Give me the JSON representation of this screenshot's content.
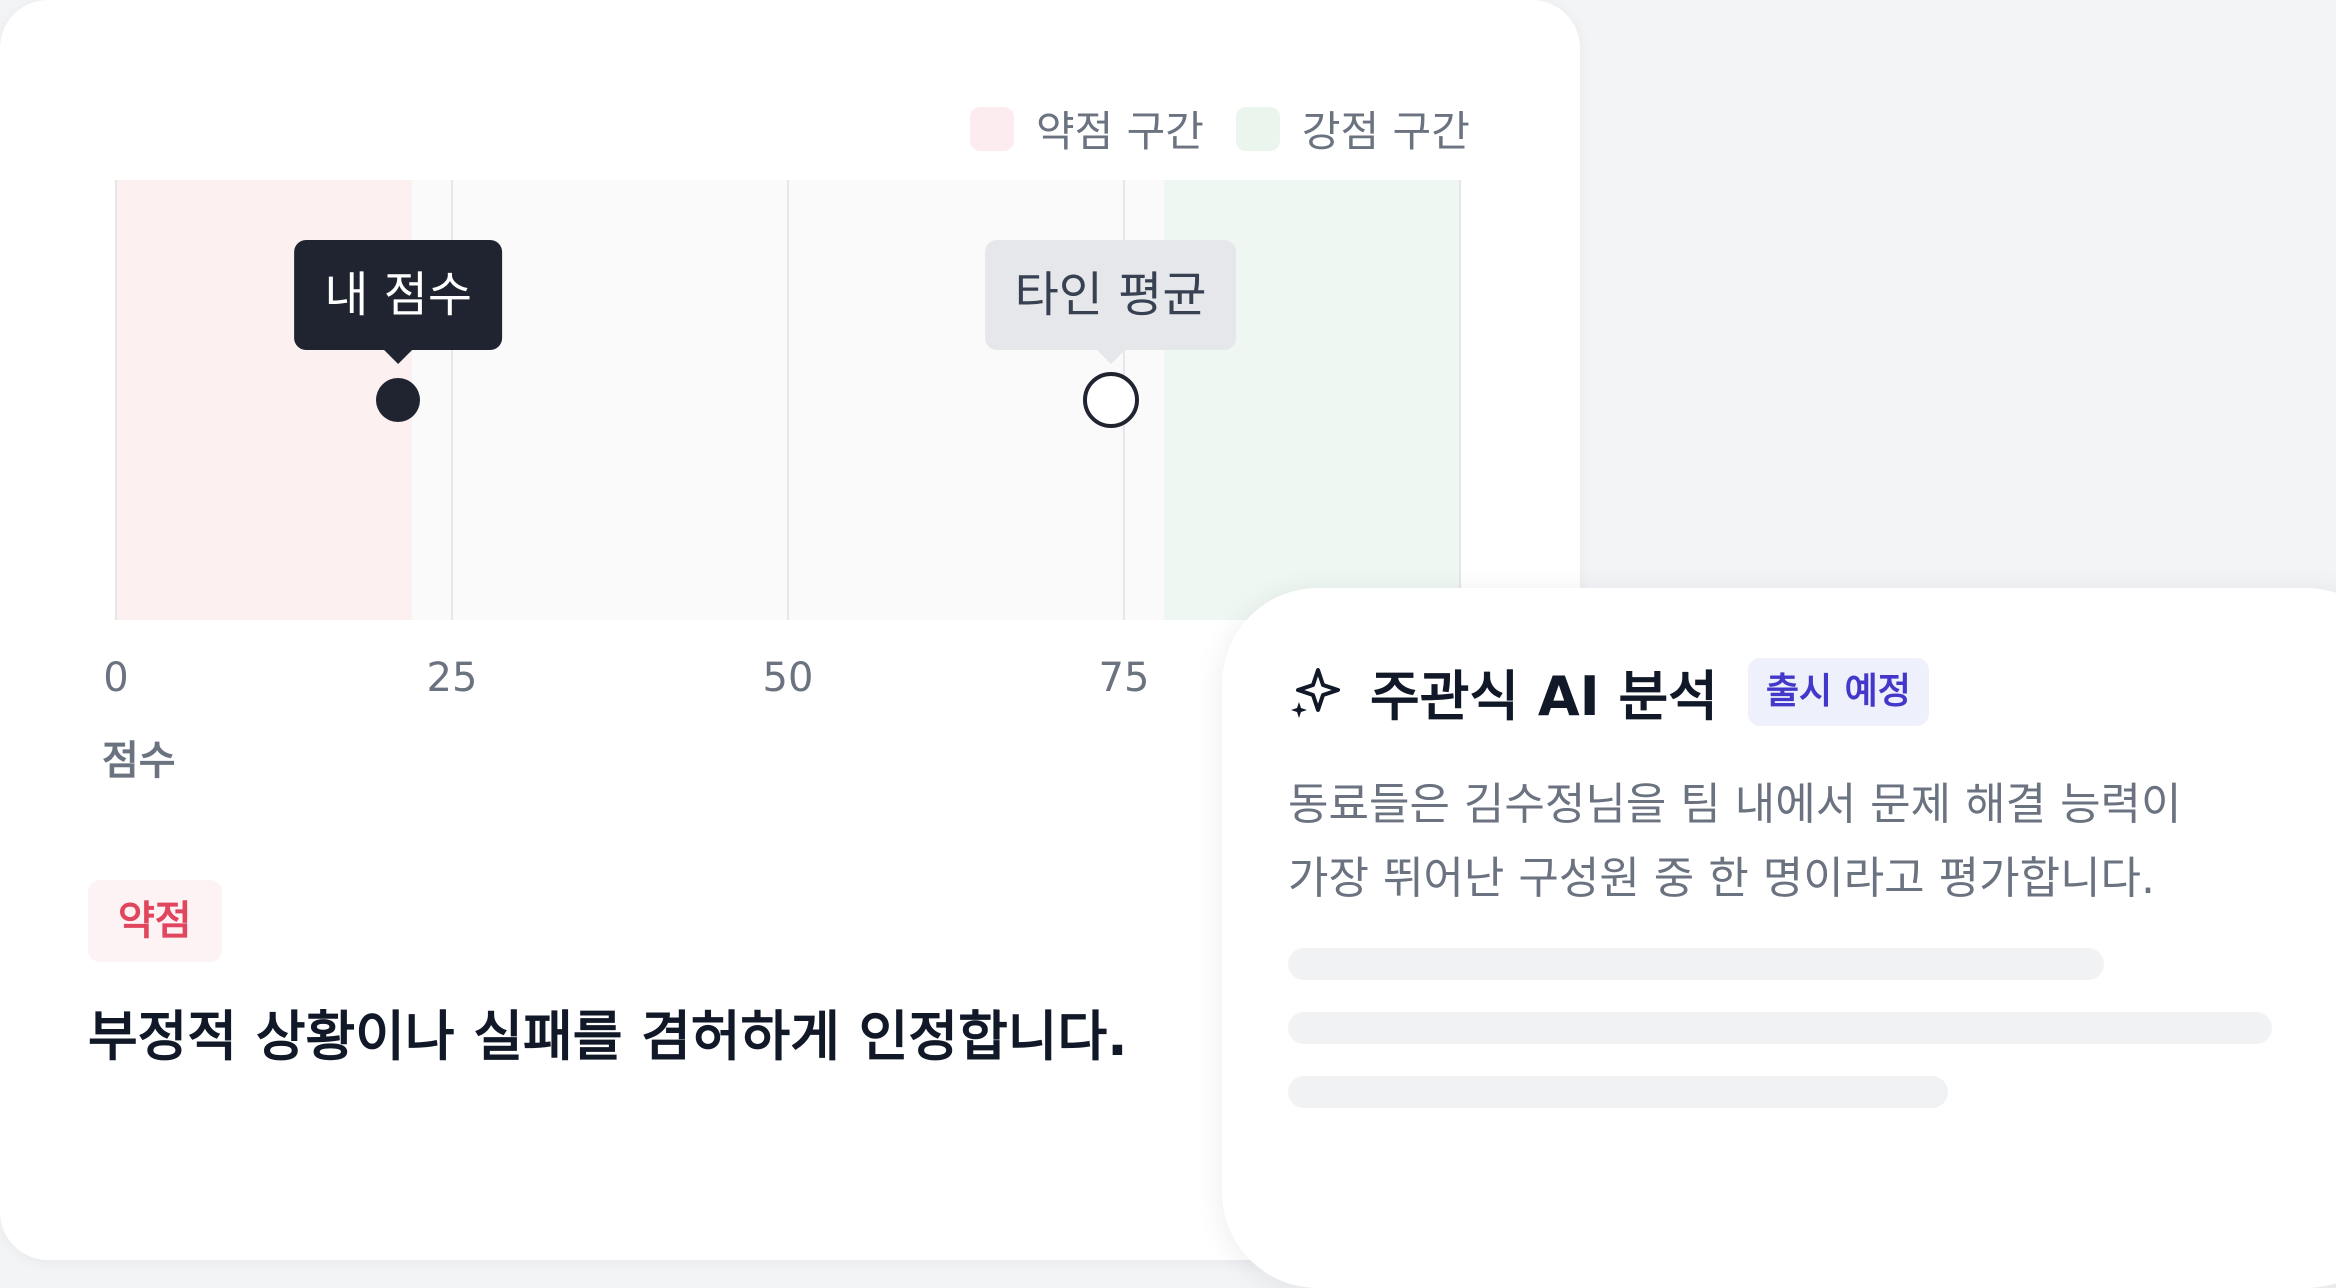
{
  "legend": {
    "weak_zone": "약점 구간",
    "strong_zone": "강점 구간"
  },
  "chart_data": {
    "type": "scatter",
    "x": [
      21,
      74
    ],
    "points": [
      {
        "label": "내 점수",
        "x": 21,
        "style": "filled"
      },
      {
        "label": "타인 평균",
        "x": 74,
        "style": "hollow"
      }
    ],
    "xlabel": "점수",
    "ticks": [
      "0",
      "25",
      "50",
      "75"
    ],
    "xlim": [
      0,
      100
    ],
    "weak_zone_range": [
      0,
      22
    ],
    "strong_zone_range": [
      78,
      100
    ],
    "grid": true,
    "legend_position": "top-right"
  },
  "item": {
    "tag": "약점",
    "statement": "부정적 상황이나 실패를 겸허하게 인정합니다."
  },
  "ai_panel": {
    "icon": "sparkle-icon",
    "title": "주관식 AI 분석",
    "badge": "출시 예정",
    "line1": "동료들은 김수정님을 팀 내에서 문제 해결 능력이",
    "line2": "가장 뛰어난 구성원 중 한 명이라고 평가합니다."
  },
  "colors": {
    "weak_zone": "#fdf0f1",
    "strong_zone": "#eef7f1",
    "marker_dark": "#1f2430",
    "accent_badge": "#4338ca"
  }
}
